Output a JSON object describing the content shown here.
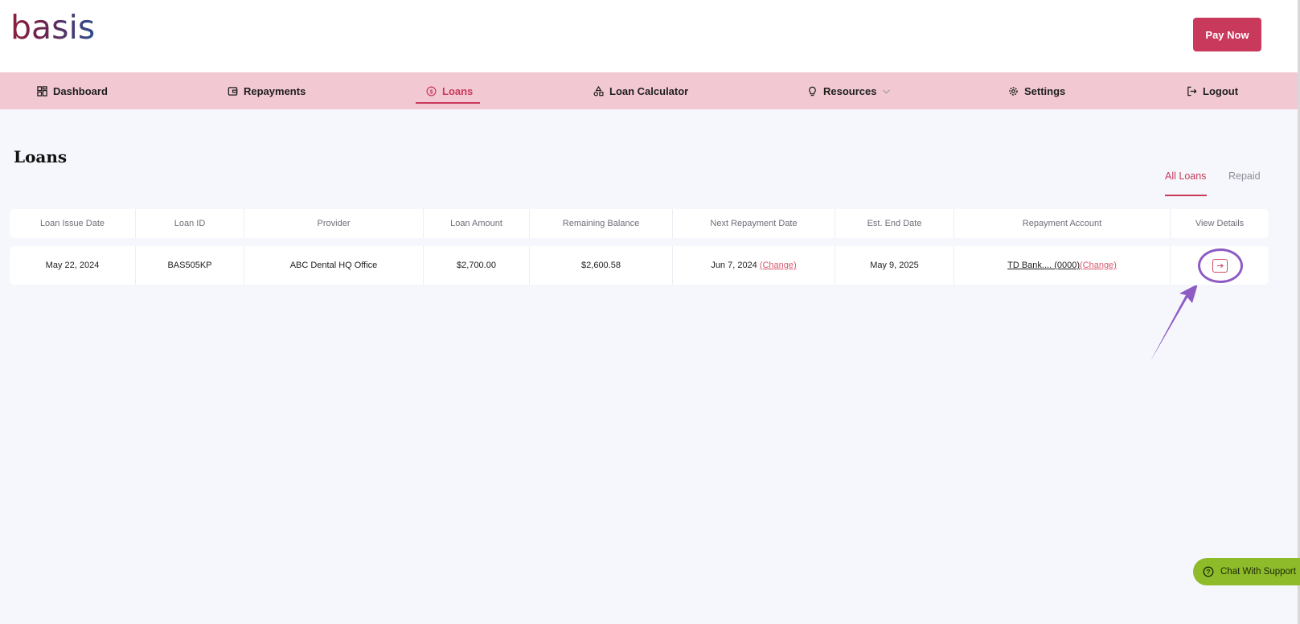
{
  "header": {
    "logo_text": "basis",
    "pay_now_label": "Pay Now"
  },
  "nav": {
    "items": [
      {
        "label": "Dashboard",
        "icon": "dashboard-icon"
      },
      {
        "label": "Repayments",
        "icon": "wallet-icon"
      },
      {
        "label": "Loans",
        "icon": "dollar-circle-icon",
        "active": true
      },
      {
        "label": "Loan Calculator",
        "icon": "shapes-icon"
      },
      {
        "label": "Resources",
        "icon": "lightbulb-icon",
        "dropdown": true
      },
      {
        "label": "Settings",
        "icon": "gear-icon"
      },
      {
        "label": "Logout",
        "icon": "logout-icon"
      }
    ]
  },
  "page": {
    "title": "Loans",
    "tabs": [
      {
        "label": "All Loans",
        "active": true
      },
      {
        "label": "Repaid",
        "active": false
      }
    ]
  },
  "table": {
    "columns": [
      "Loan Issue Date",
      "Loan ID",
      "Provider",
      "Loan Amount",
      "Remaining Balance",
      "Next Repayment Date",
      "Est. End Date",
      "Repayment Account",
      "View Details"
    ],
    "rows": [
      {
        "issue_date": "May 22, 2024",
        "loan_id": "BAS505KP",
        "provider": "ABC Dental HQ Office",
        "amount": "$2,700.00",
        "remaining": "$2,600.58",
        "next_repayment": "Jun 7, 2024",
        "next_repayment_change": "(Change)",
        "est_end": "May 9, 2025",
        "account": "TD Bank.... (0000)",
        "account_change": "(Change)",
        "view_icon": "arrow-right-icon"
      }
    ]
  },
  "support": {
    "chat_label": "Chat With Support",
    "icon": "question-circle-icon"
  },
  "colors": {
    "brand": "#c8395c",
    "nav_bg": "#f2c9d3",
    "page_bg": "#f6f7fc",
    "chat_bg": "#8dbb2a",
    "annotation": "#8e5bc4"
  }
}
